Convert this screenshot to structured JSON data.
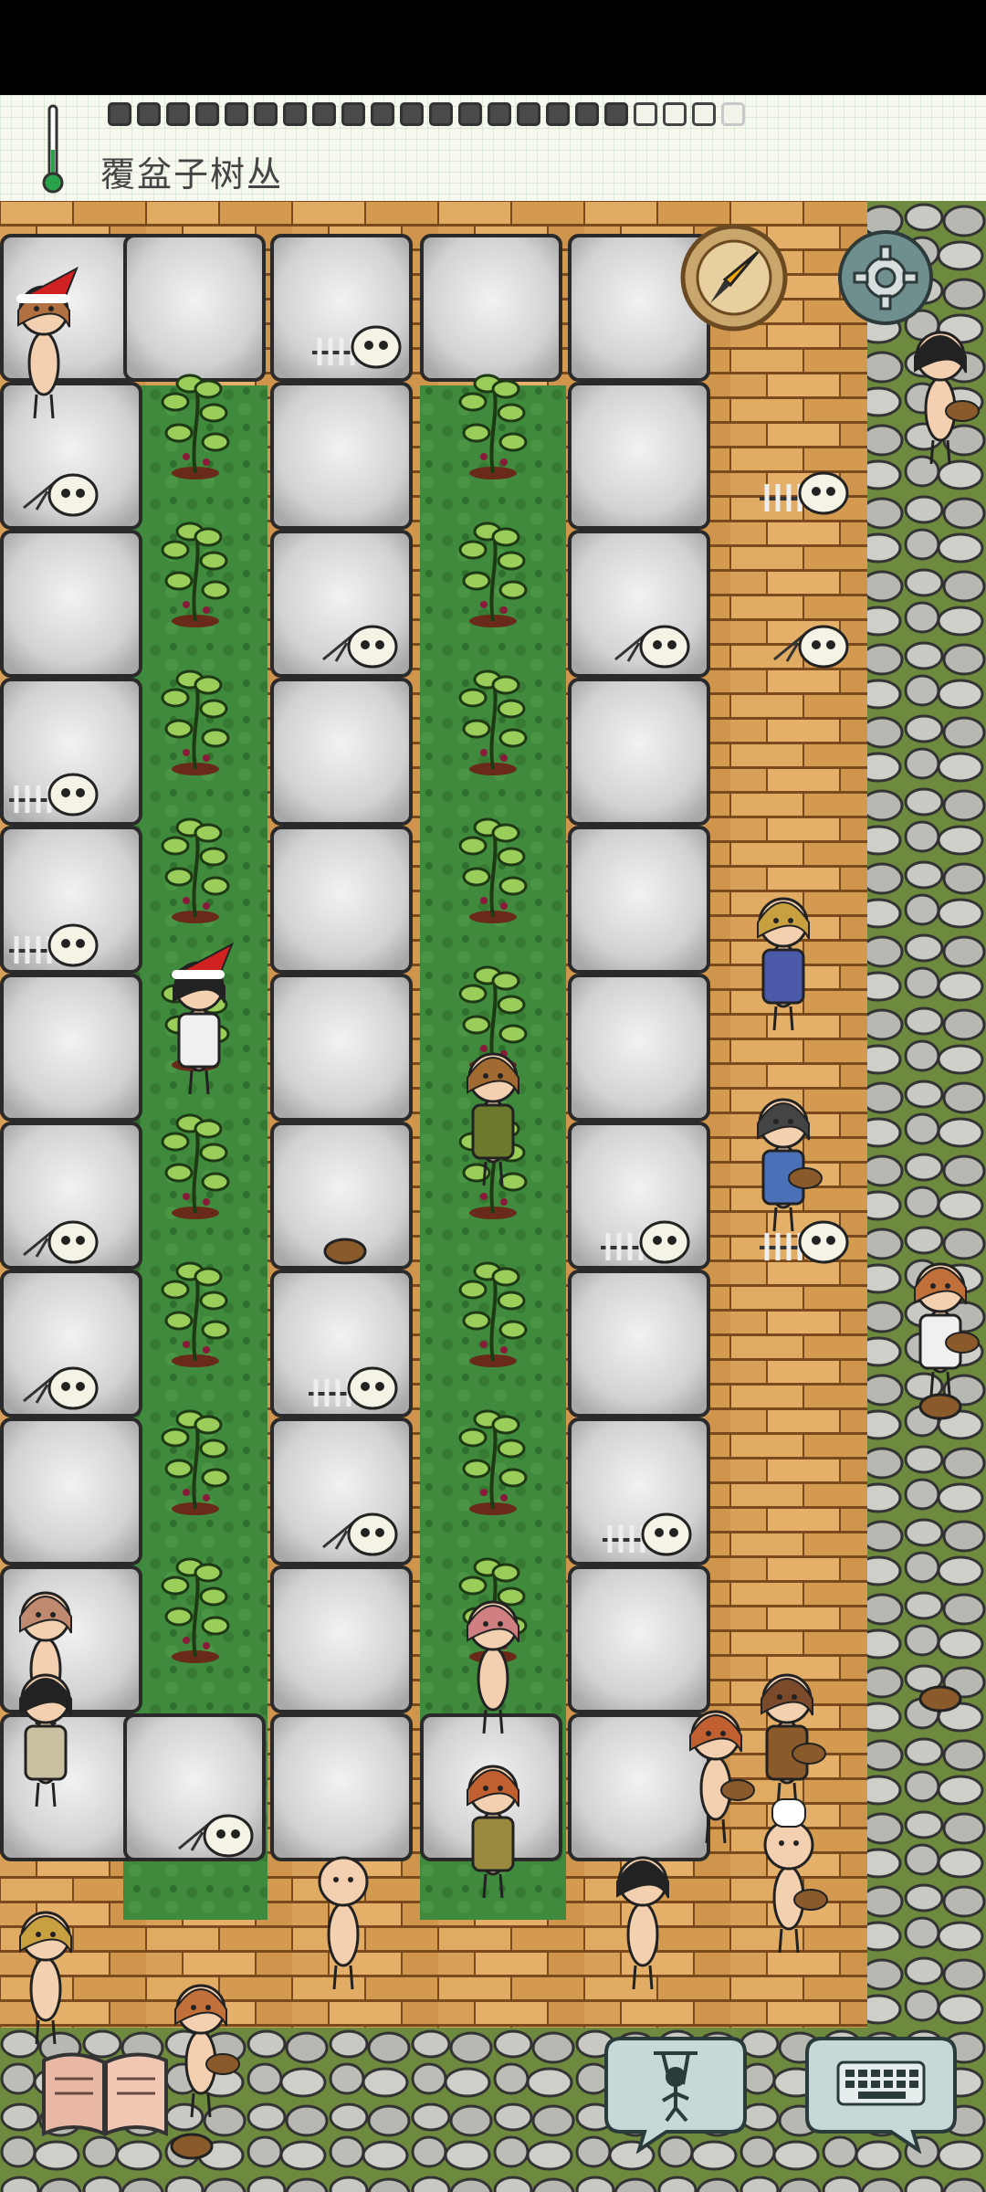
{
  "hud": {
    "held_item": "覆盆子树丛",
    "food_pips": {
      "full": 18,
      "empty": 3,
      "faint": 1
    },
    "thermometer_icon": "thermometer-icon"
  },
  "controls": {
    "compass": "compass-icon",
    "settings": "gear-icon",
    "recipe_book": "recipe-book-icon",
    "emote": "puppet-emote-icon",
    "keyboard": "keyboard-icon"
  },
  "colors": {
    "stone_tile": "#d8d8d8",
    "grass": "#3f8a3c",
    "wood_floor": "#d9a25a",
    "cobble": "#b7b7b2",
    "accent_compass": "#c9a66b",
    "settings_bg": "#6f8f8f"
  }
}
